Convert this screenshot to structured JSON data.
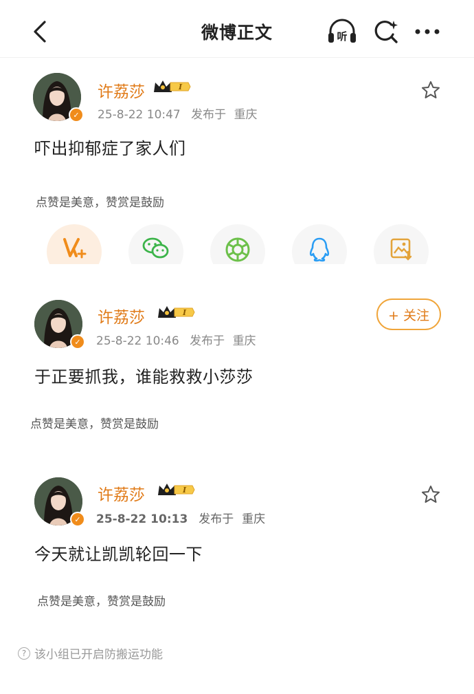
{
  "nav": {
    "title": "微博正文",
    "listen_label": "听"
  },
  "posts": [
    {
      "username": "许荔莎",
      "level": "I",
      "timestamp": "25-8-22 10:47",
      "location_prefix": "发布于",
      "location": "重庆",
      "content": "吓出抑郁症了家人们",
      "reward_text": "点赞是美意，赞赏是鼓励",
      "action": "star"
    },
    {
      "username": "许荔莎",
      "level": "I",
      "timestamp": "25-8-22 10:46",
      "location_prefix": "发布于",
      "location": "重庆",
      "content": "于正要抓我，谁能救救小莎莎",
      "reward_text": "点赞是美意，赞赏是鼓励",
      "action": "follow",
      "follow_label": "+ 关注"
    },
    {
      "username": "许荔莎",
      "level": "I",
      "timestamp": "25-8-22 10:13",
      "location_prefix": "发布于",
      "location": "重庆",
      "content": "今天就让凯凯轮回一下",
      "reward_text": "点赞是美意，赞赏是鼓励",
      "action": "star"
    }
  ],
  "share_targets": [
    "weibo-icon",
    "wechat-icon",
    "moments-icon",
    "qq-icon",
    "save-image-icon"
  ],
  "footer": {
    "note": "该小组已开启防搬运功能",
    "help_glyph": "?"
  },
  "colors": {
    "accent": "#e07a17",
    "follow_border": "#f0a53a",
    "badge": "#f08c1b"
  }
}
